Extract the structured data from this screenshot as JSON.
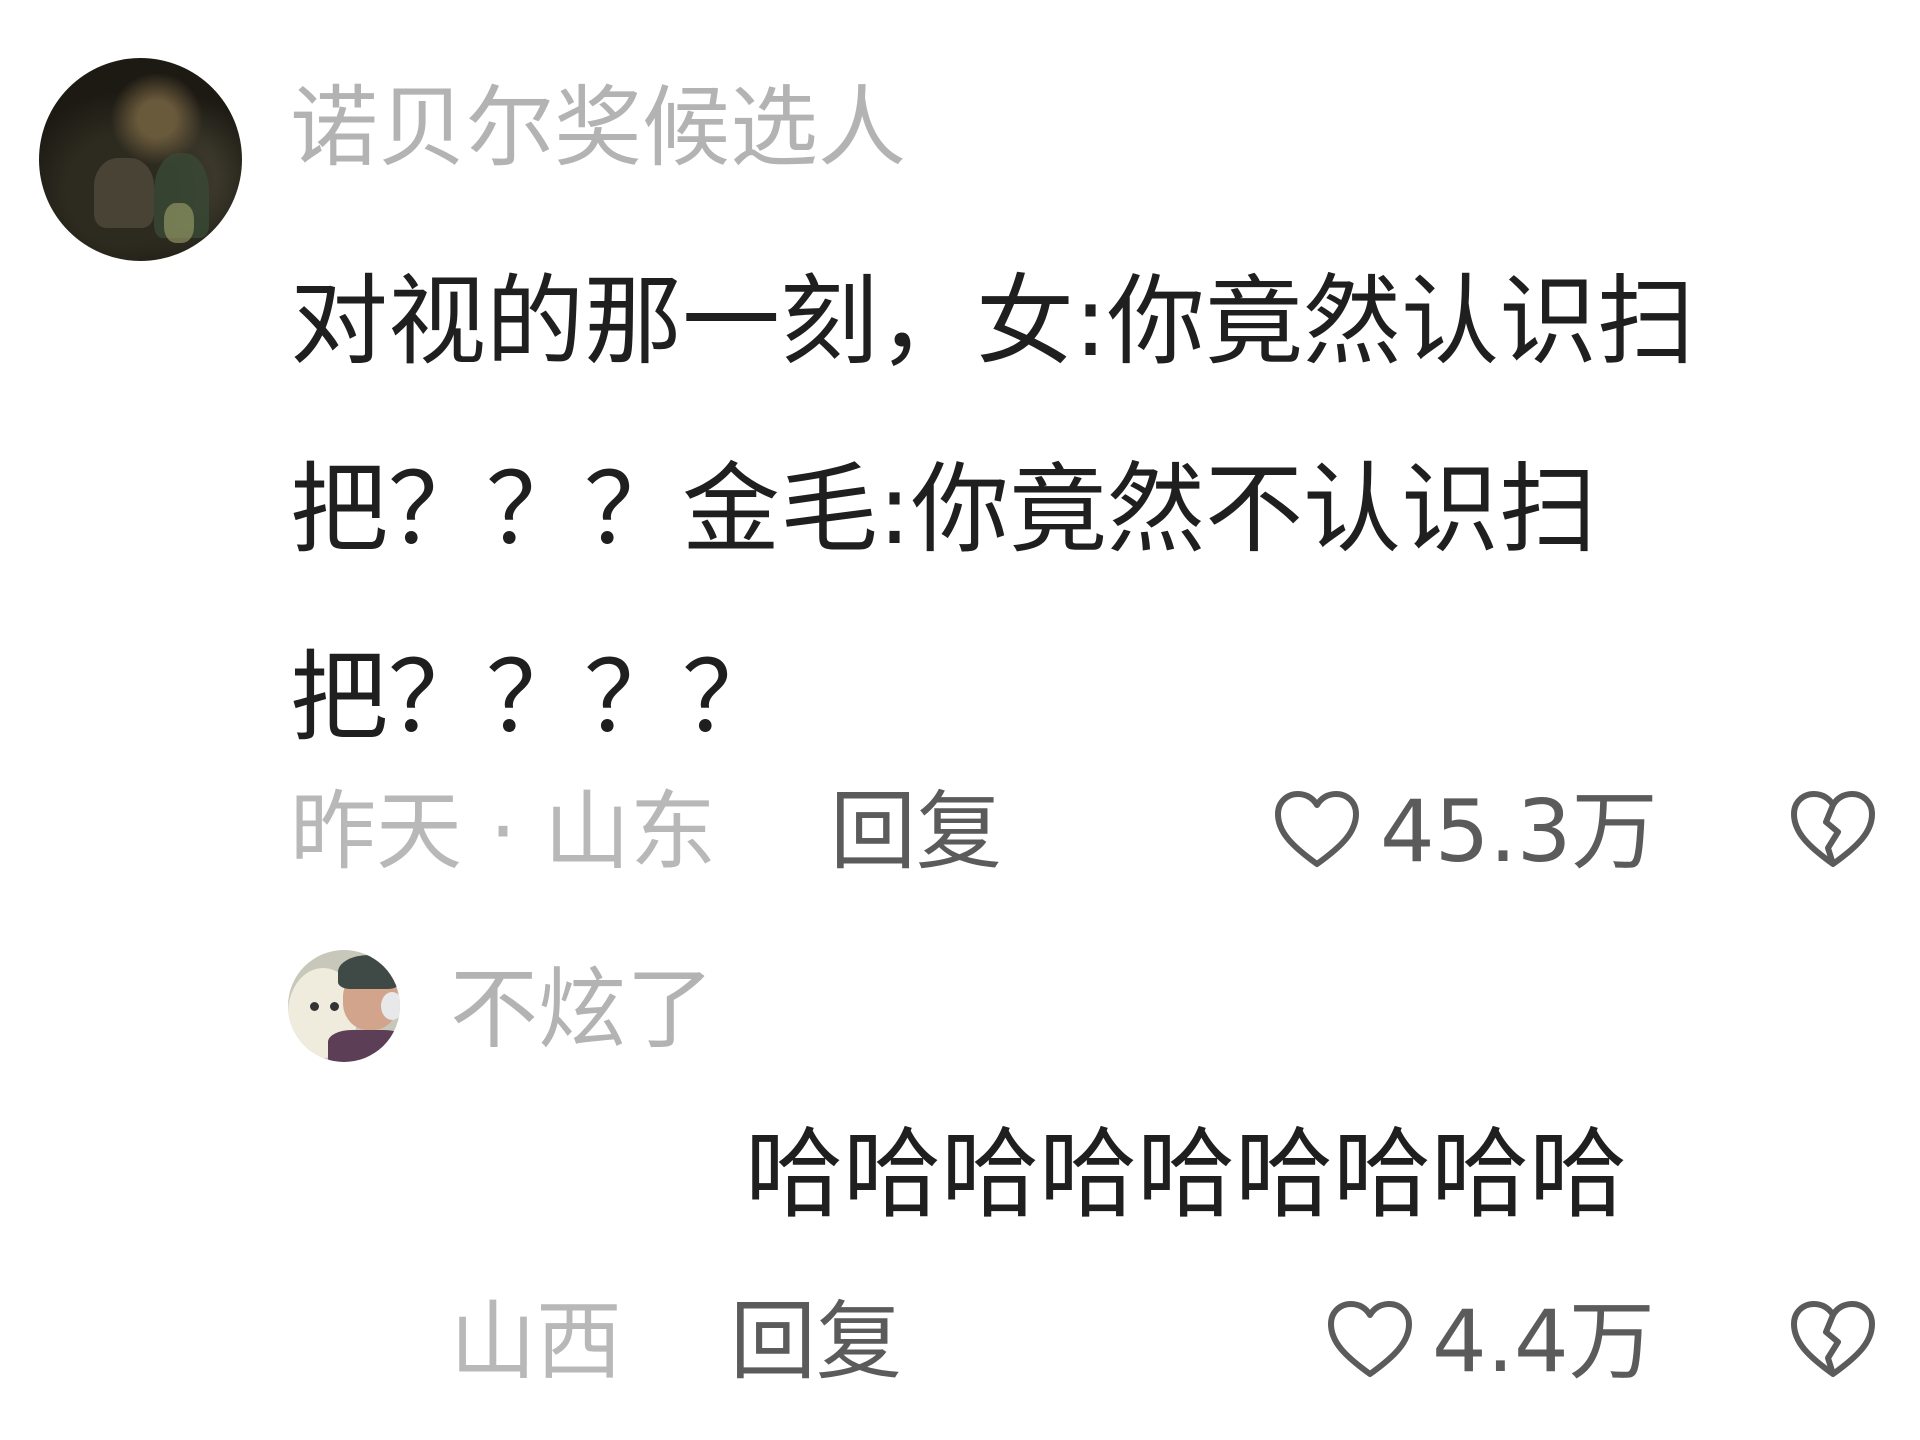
{
  "comment": {
    "username": "诺贝尔奖候选人",
    "text_lines": [
      "对视的那一刻，女:你竟然认识扫",
      "把？？？金毛:你竟然不认识扫",
      "把？？？？"
    ],
    "meta": "昨天 · 山东",
    "reply_label": "回复",
    "like_count": "45.3万"
  },
  "reply": {
    "username": "不炫了",
    "text": "哈哈哈哈哈哈哈哈哈",
    "meta": "山西",
    "reply_label": "回复",
    "like_count": "4.4万"
  },
  "icons": {
    "like": "heart-outline-icon",
    "dislike": "broken-heart-icon"
  },
  "colors": {
    "username": "#b3b3b3",
    "text": "#1f1f1f",
    "action": "#5b5b5b"
  }
}
